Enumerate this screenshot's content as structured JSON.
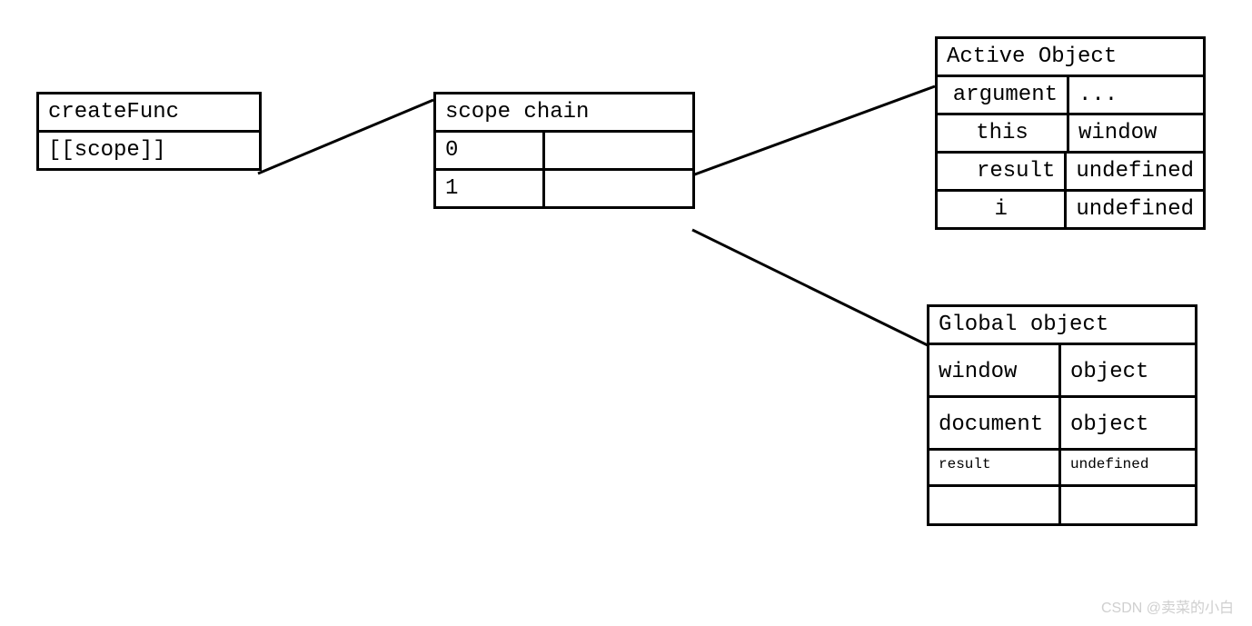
{
  "createFunc": {
    "title": "createFunc",
    "row0": "[[scope]]"
  },
  "scopeChain": {
    "title": "scope chain",
    "rows": [
      {
        "index": "0",
        "value": ""
      },
      {
        "index": "1",
        "value": ""
      }
    ]
  },
  "activeObject": {
    "title": "Active Object",
    "rows": [
      {
        "key": "argument",
        "value": "..."
      },
      {
        "key": "this",
        "value": "window"
      },
      {
        "key": "result",
        "value": "undefined"
      },
      {
        "key": "i",
        "value": "undefined"
      }
    ]
  },
  "globalObject": {
    "title": "Global object",
    "rows": [
      {
        "key": "window",
        "value": "object"
      },
      {
        "key": "document",
        "value": "object"
      },
      {
        "key": "result",
        "value": "undefined"
      },
      {
        "key": "",
        "value": ""
      }
    ]
  },
  "watermark": "CSDN @卖菜的小白"
}
